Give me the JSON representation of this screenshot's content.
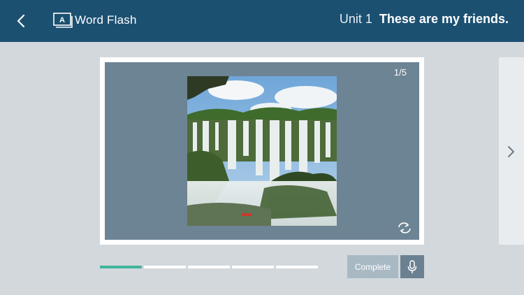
{
  "header": {
    "app_title": "Word Flash",
    "unit_label": "Unit 1",
    "unit_title": "These are my friends.",
    "back_icon": "chevron-left-icon",
    "app_icon": "word-flash-icon"
  },
  "card": {
    "counter": "1/5",
    "image_subject": "waterfall photo",
    "flip_icon": "flip-arrows-icon"
  },
  "next_icon": "chevron-right-icon",
  "progress": {
    "total_segments": 5,
    "current_segment": 1
  },
  "actions": {
    "complete_label": "Complete",
    "mic_icon": "microphone-icon"
  },
  "colors": {
    "header_bg": "#1b5071",
    "card_bg": "#6d8494",
    "progress_active": "#3fb59a",
    "page_bg": "#d2d8dc"
  }
}
